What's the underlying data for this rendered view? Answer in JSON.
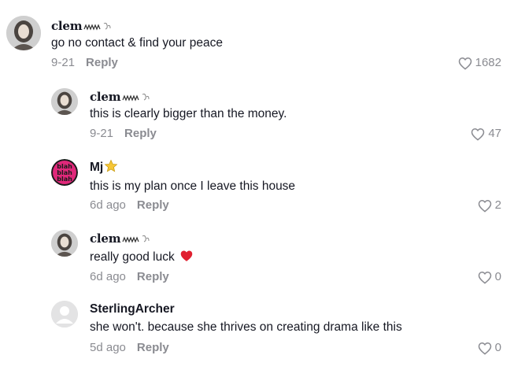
{
  "comments": [
    {
      "username": "clem",
      "text": "go no contact & find your peace",
      "date": "9-21",
      "reply_label": "Reply",
      "likes": "1682",
      "avatar_icon": "portrait-avatar"
    },
    {
      "username": "clem",
      "text": "this is clearly bigger than the money.",
      "date": "9-21",
      "reply_label": "Reply",
      "likes": "47",
      "avatar_icon": "portrait-avatar"
    },
    {
      "username": "Mj",
      "text": "this is my plan once I leave this house",
      "date": "6d ago",
      "reply_label": "Reply",
      "likes": "2",
      "avatar_icon": "blah-pattern-avatar"
    },
    {
      "username": "clem",
      "text": "really good luck",
      "date": "6d ago",
      "reply_label": "Reply",
      "likes": "0",
      "avatar_icon": "portrait-avatar"
    },
    {
      "username": "SterlingArcher",
      "text": "she won't. because she thrives on creating drama like this",
      "date": "5d ago",
      "reply_label": "Reply",
      "likes": "0",
      "avatar_icon": "default-avatar"
    }
  ],
  "colors": {
    "text": "#161823",
    "muted": "#8a8b91",
    "heart_emoji": "#e02030",
    "star_emoji": "#f6c636",
    "mj_avatar": "#e0287a"
  }
}
